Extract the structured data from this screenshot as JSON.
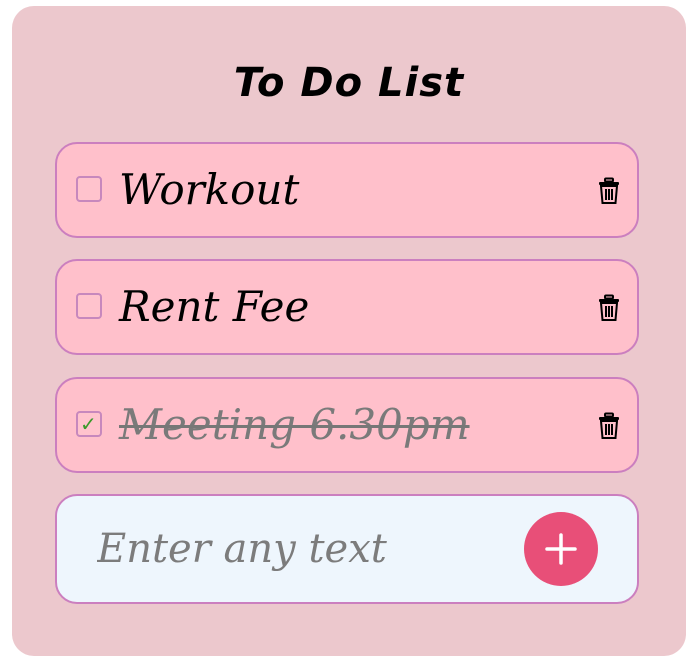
{
  "app": {
    "title": "To Do List"
  },
  "todos": [
    {
      "text": "Workout",
      "completed": false,
      "delete_icon": "trash-icon"
    },
    {
      "text": "Rent Fee",
      "completed": false,
      "delete_icon": "trash-icon"
    },
    {
      "text": "Meeting 6.30pm",
      "completed": true,
      "delete_icon": "trash-icon"
    }
  ],
  "add_form": {
    "placeholder": "Enter any text",
    "value": "",
    "button_icon": "plus-icon"
  },
  "colors": {
    "card_background": "#ecc8cd",
    "item_background": "#ffc0cb",
    "item_border": "#cb7fbf",
    "input_background": "#eef6fd",
    "add_button": "#e84f78",
    "check_mark": "#3a9a2a",
    "completed_text": "#7a7a7a"
  },
  "check_glyph": "✓"
}
